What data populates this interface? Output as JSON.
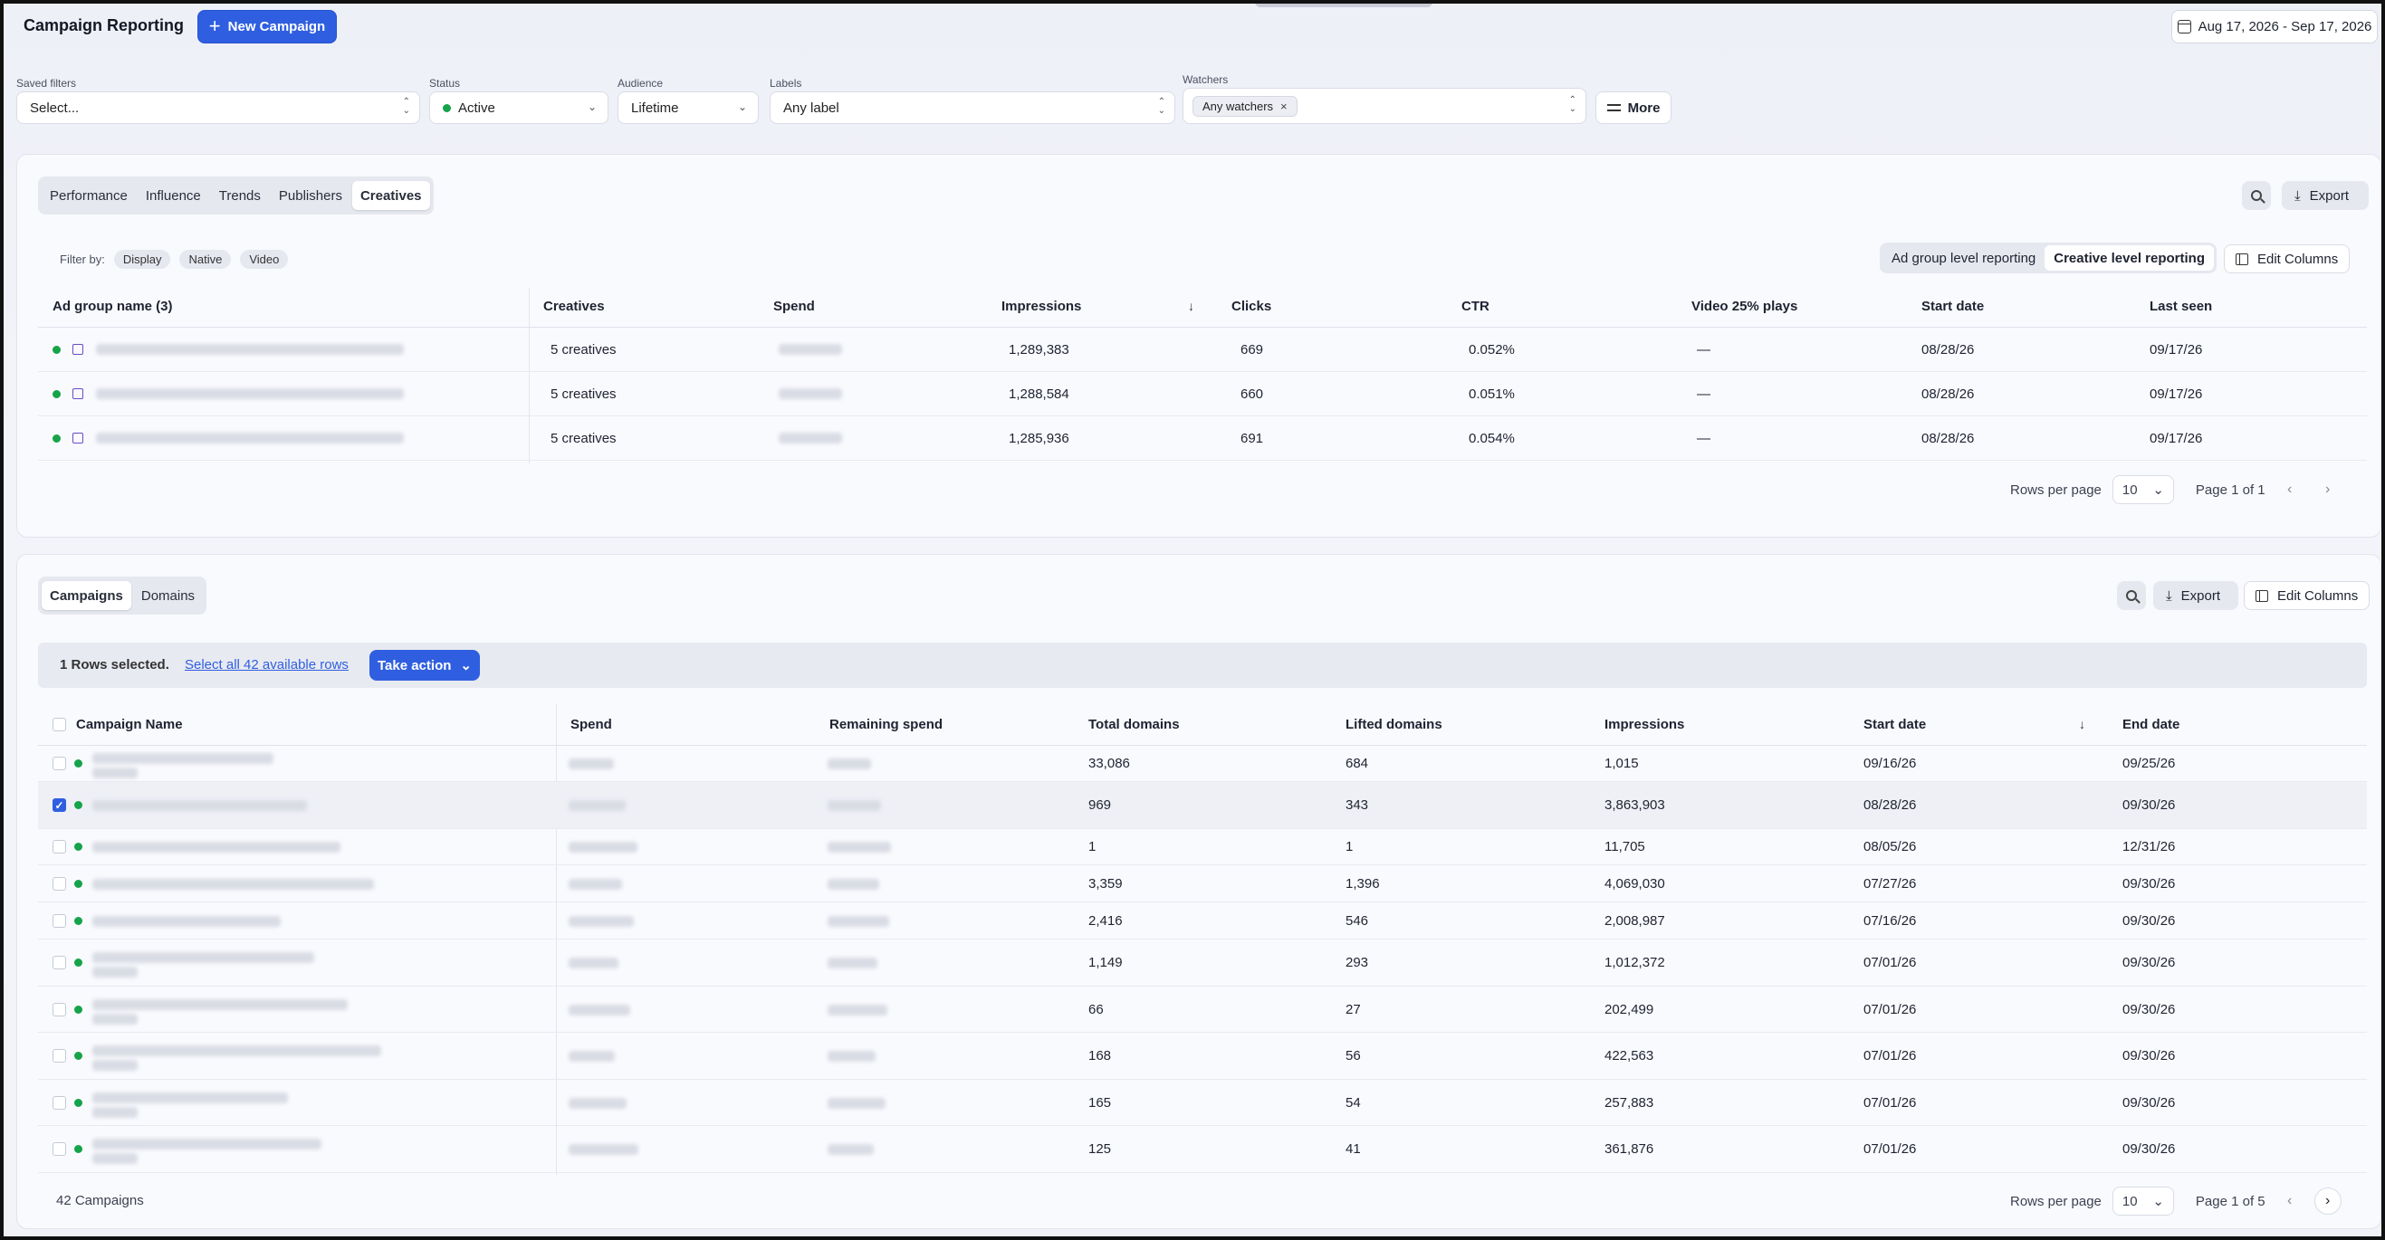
{
  "header": {
    "title": "Campaign Reporting",
    "new_campaign_label": "New Campaign",
    "date_range": "Aug 17, 2026 - Sep 17, 2026"
  },
  "filters": {
    "saved": {
      "label": "Saved filters",
      "value": "Select..."
    },
    "status": {
      "label": "Status",
      "value": "Active"
    },
    "audience": {
      "label": "Audience",
      "value": "Lifetime"
    },
    "labels": {
      "label": "Labels",
      "value": "Any label"
    },
    "watchers": {
      "label": "Watchers",
      "chip": "Any watchers"
    },
    "more_label": "More"
  },
  "creatives_panel": {
    "tabs": [
      "Performance",
      "Influence",
      "Trends",
      "Publishers",
      "Creatives"
    ],
    "active_tab": "Creatives",
    "export_label": "Export",
    "filter_by_label": "Filter by:",
    "filter_pills": [
      "Display",
      "Native",
      "Video"
    ],
    "reporting_toggle": [
      "Ad group level reporting",
      "Creative level reporting"
    ],
    "reporting_active": "Creative level reporting",
    "edit_columns_label": "Edit Columns",
    "columns": [
      "Ad group name (3)",
      "Creatives",
      "Spend",
      "Impressions",
      "Clicks",
      "CTR",
      "Video 25% plays",
      "Start date",
      "Last seen"
    ],
    "sorted_column": "Impressions",
    "rows": [
      {
        "creatives": "5 creatives",
        "impressions": "1,289,383",
        "clicks": "669",
        "ctr": "0.052%",
        "video": "—",
        "start": "08/28/26",
        "last_seen": "09/17/26"
      },
      {
        "creatives": "5 creatives",
        "impressions": "1,288,584",
        "clicks": "660",
        "ctr": "0.051%",
        "video": "—",
        "start": "08/28/26",
        "last_seen": "09/17/26"
      },
      {
        "creatives": "5 creatives",
        "impressions": "1,285,936",
        "clicks": "691",
        "ctr": "0.054%",
        "video": "—",
        "start": "08/28/26",
        "last_seen": "09/17/26"
      }
    ],
    "pager": {
      "rows_per_page_label": "Rows per page",
      "rows_per_page": "10",
      "page_text": "Page 1 of 1"
    }
  },
  "campaigns_panel": {
    "tabs": [
      "Campaigns",
      "Domains"
    ],
    "active_tab": "Campaigns",
    "export_label": "Export",
    "edit_columns_label": "Edit Columns",
    "selection": {
      "text": "1 Rows selected.",
      "select_all": "Select all 42 available rows",
      "take_action": "Take action"
    },
    "columns": [
      "Campaign Name",
      "Spend",
      "Remaining spend",
      "Total domains",
      "Lifted domains",
      "Impressions",
      "Start date",
      "End date"
    ],
    "sorted_column": "Start date",
    "rows": [
      {
        "checked": false,
        "total": "33,086",
        "lifted": "684",
        "impressions": "1,015",
        "start": "09/16/26",
        "end": "09/25/26"
      },
      {
        "checked": true,
        "total": "969",
        "lifted": "343",
        "impressions": "3,863,903",
        "start": "08/28/26",
        "end": "09/30/26"
      },
      {
        "checked": false,
        "total": "1",
        "lifted": "1",
        "impressions": "11,705",
        "start": "08/05/26",
        "end": "12/31/26"
      },
      {
        "checked": false,
        "total": "3,359",
        "lifted": "1,396",
        "impressions": "4,069,030",
        "start": "07/27/26",
        "end": "09/30/26"
      },
      {
        "checked": false,
        "total": "2,416",
        "lifted": "546",
        "impressions": "2,008,987",
        "start": "07/16/26",
        "end": "09/30/26"
      },
      {
        "checked": false,
        "total": "1,149",
        "lifted": "293",
        "impressions": "1,012,372",
        "start": "07/01/26",
        "end": "09/30/26"
      },
      {
        "checked": false,
        "total": "66",
        "lifted": "27",
        "impressions": "202,499",
        "start": "07/01/26",
        "end": "09/30/26"
      },
      {
        "checked": false,
        "total": "168",
        "lifted": "56",
        "impressions": "422,563",
        "start": "07/01/26",
        "end": "09/30/26"
      },
      {
        "checked": false,
        "total": "165",
        "lifted": "54",
        "impressions": "257,883",
        "start": "07/01/26",
        "end": "09/30/26"
      },
      {
        "checked": false,
        "total": "125",
        "lifted": "41",
        "impressions": "361,876",
        "start": "07/01/26",
        "end": "09/30/26"
      }
    ],
    "footer_count": "42 Campaigns",
    "pager": {
      "rows_per_page_label": "Rows per page",
      "rows_per_page": "10",
      "page_text": "Page 1 of 5"
    }
  },
  "colors": {
    "accent": "#2f5fe0",
    "status_active": "#16a34a"
  }
}
